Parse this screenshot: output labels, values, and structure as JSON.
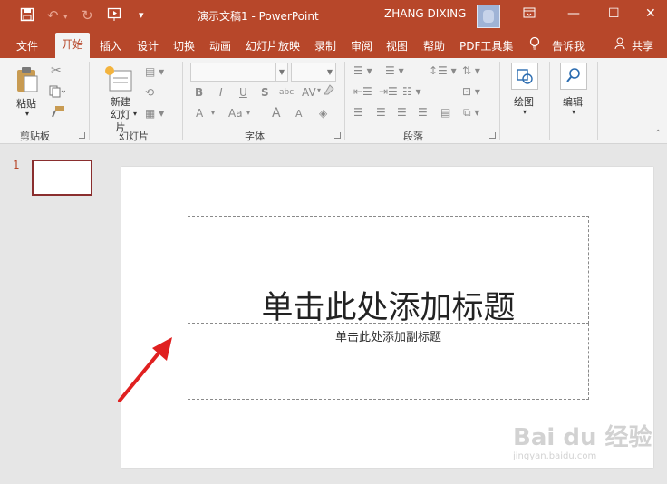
{
  "titlebar": {
    "doc_title": "演示文稿1  -  PowerPoint",
    "user_name": "ZHANG DIXING",
    "qa_icons": [
      "save-icon",
      "undo-icon",
      "redo-icon",
      "present-icon",
      "customize-icon"
    ],
    "window_icons": [
      "ribbon-display-icon",
      "minimize-icon",
      "maximize-icon",
      "close-icon"
    ]
  },
  "tabs": [
    {
      "label": "文件"
    },
    {
      "label": "开始"
    },
    {
      "label": "插入"
    },
    {
      "label": "设计"
    },
    {
      "label": "切换"
    },
    {
      "label": "动画"
    },
    {
      "label": "幻灯片放映"
    },
    {
      "label": "录制"
    },
    {
      "label": "审阅"
    },
    {
      "label": "视图"
    },
    {
      "label": "帮助"
    },
    {
      "label": "PDF工具集"
    }
  ],
  "active_tab": "开始",
  "tell_me": "告诉我",
  "share": "共享",
  "ribbon": {
    "clipboard": {
      "paste": "粘贴",
      "group": "剪贴板"
    },
    "slides": {
      "new_slide": "新建\n幻灯片",
      "group": "幻灯片"
    },
    "font": {
      "group": "字体",
      "format_buttons": [
        "B",
        "I",
        "U",
        "S",
        "abc",
        "AV",
        "A",
        "Aa",
        "A",
        "A"
      ]
    },
    "paragraph": {
      "group": "段落"
    },
    "drawing": {
      "label": "绘图"
    },
    "editing": {
      "label": "编辑"
    }
  },
  "thumbnails": {
    "slide_number": "1"
  },
  "slide": {
    "title_placeholder": "单击此处添加标题",
    "subtitle_placeholder": "单击此处添加副标题"
  },
  "watermark": {
    "brand": "Bai du 经验",
    "url": "jingyan.baidu.com"
  },
  "colors": {
    "accent": "#b7472a",
    "arrow": "#e02020",
    "thumb_border": "#8a2e2e"
  }
}
